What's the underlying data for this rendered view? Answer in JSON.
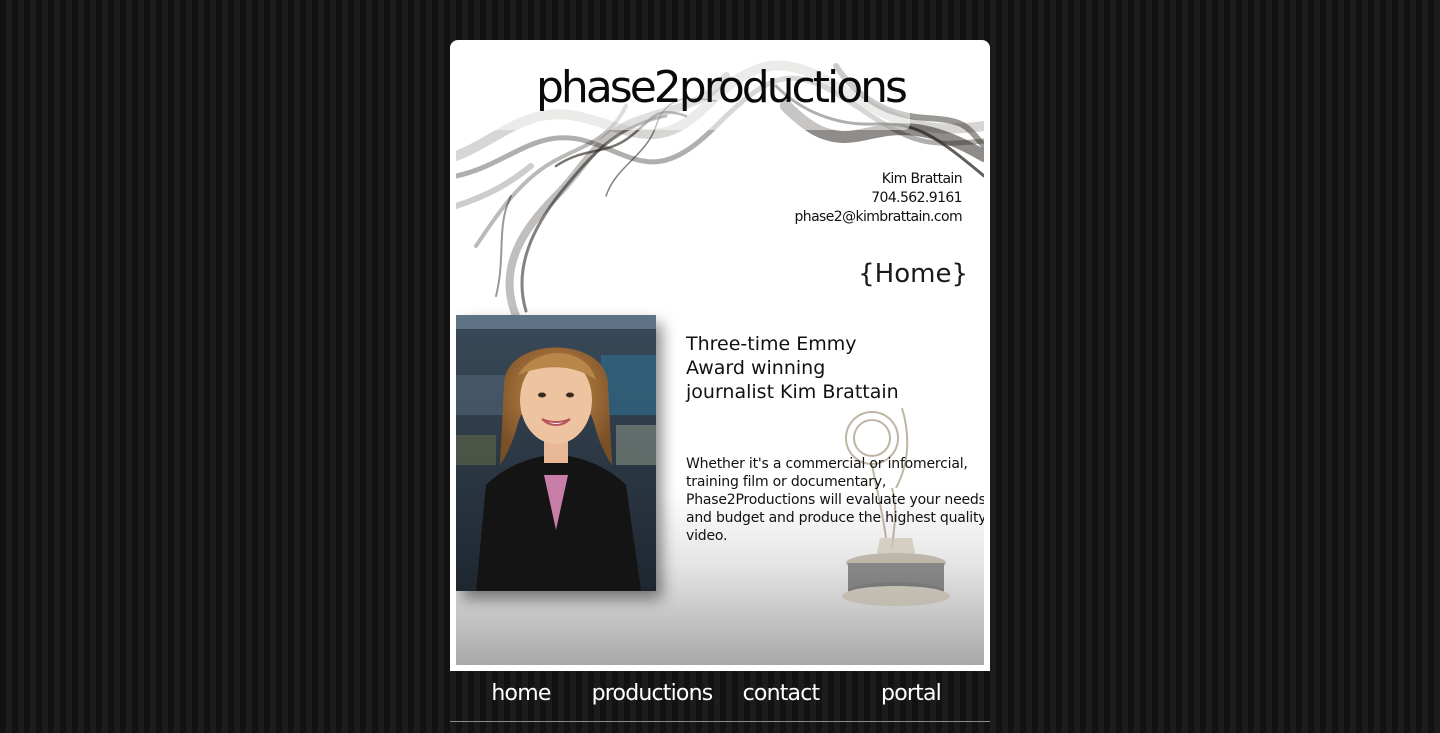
{
  "header": {
    "site_title": "phase2productions"
  },
  "contact": {
    "name": "Kim Brattain",
    "phone": "704.562.9161",
    "email": "phase2@kimbrattain.com"
  },
  "page": {
    "label": "{Home}"
  },
  "content": {
    "headline": [
      "Three-time Emmy",
      "Award winning",
      "journalist Kim Brattain"
    ],
    "blurb": [
      "Whether it's a commercial or infomercial,",
      "training film or documentary,",
      "Phase2Productions will evaluate your needs",
      "and budget and produce the highest quality",
      "video."
    ]
  },
  "nav": {
    "items": [
      {
        "label": "home"
      },
      {
        "label": "productions"
      },
      {
        "label": "contact"
      },
      {
        "label": "portal"
      }
    ]
  },
  "colors": {
    "background": "#141414",
    "frame": "#ffffff",
    "nav_text": "#ffffff",
    "text": "#111111"
  }
}
